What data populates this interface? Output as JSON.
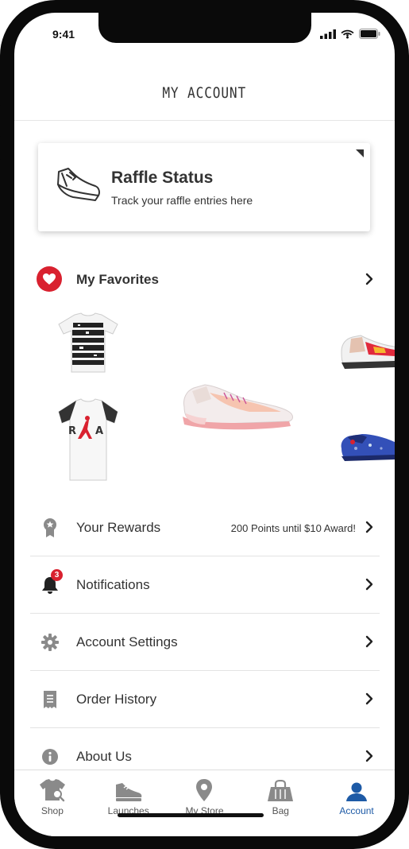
{
  "status_bar": {
    "time": "9:41"
  },
  "header": {
    "title": "MY ACCOUNT"
  },
  "raffle": {
    "title": "Raffle Status",
    "subtitle": "Track your raffle entries here"
  },
  "favorites": {
    "label": "My Favorites",
    "items": [
      {
        "name": "graphic-tee-black-print"
      },
      {
        "name": "jordan-jumpman-tee"
      },
      {
        "name": "nike-air-max-270-react-sneaker"
      },
      {
        "name": "multicolor-sneaker"
      },
      {
        "name": "galaxy-clog"
      }
    ]
  },
  "menu": [
    {
      "key": "rewards",
      "label": "Your Rewards",
      "extra": "200 Points until $10 Award!",
      "icon": "rewards-ribbon-icon"
    },
    {
      "key": "notifications",
      "label": "Notifications",
      "badge": "3",
      "icon": "bell-icon"
    },
    {
      "key": "settings",
      "label": "Account Settings",
      "icon": "gear-icon"
    },
    {
      "key": "orders",
      "label": "Order History",
      "icon": "receipt-icon"
    },
    {
      "key": "about",
      "label": "About Us",
      "icon": "info-icon"
    }
  ],
  "tabs": [
    {
      "key": "shop",
      "label": "Shop",
      "icon": "shirt-search-icon",
      "active": false
    },
    {
      "key": "launches",
      "label": "Launches",
      "icon": "sneaker-icon",
      "active": false
    },
    {
      "key": "store",
      "label": "My Store",
      "icon": "location-pin-icon",
      "active": false
    },
    {
      "key": "bag",
      "label": "Bag",
      "icon": "shopping-bag-icon",
      "active": false
    },
    {
      "key": "account",
      "label": "Account",
      "icon": "user-icon",
      "active": true
    }
  ],
  "colors": {
    "accent": "#1d5aa6",
    "brand_red": "#d9212f",
    "text": "#333333",
    "inactive_icon": "#8a8a8a"
  }
}
